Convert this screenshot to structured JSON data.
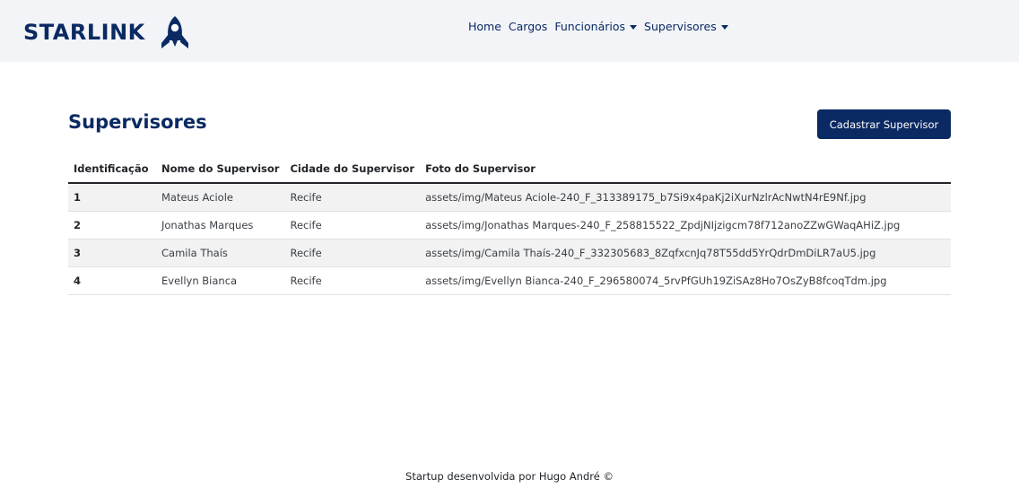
{
  "navbar": {
    "brand": "STARLINK",
    "logo_icon": "rocket-icon",
    "links": [
      "Home",
      "Cargos"
    ],
    "dropdowns": [
      "Funcionários",
      "Supervisores"
    ]
  },
  "page": {
    "title": "Supervisores",
    "add_button": "Cadastrar Supervisor"
  },
  "table": {
    "headers": [
      "Identificação",
      "Nome do Supervisor",
      "Cidade do Supervisor",
      "Foto do Supervisor"
    ],
    "rows": [
      [
        "1",
        "Mateus Aciole",
        "Recife",
        "assets/img/Mateus Aciole-240_F_313389175_b7Si9x4paKj2iXurNzlrAcNwtN4rE9Nf.jpg"
      ],
      [
        "2",
        "Jonathas Marques",
        "Recife",
        "assets/img/Jonathas Marques-240_F_258815522_ZpdjNIjzigcm78f712anoZZwGWaqAHiZ.jpg"
      ],
      [
        "3",
        "Camila Thaís",
        "Recife",
        "assets/img/Camila Thaís-240_F_332305683_8ZqfxcnJq78T55dd5YrQdrDmDiLR7aU5.jpg"
      ],
      [
        "4",
        "Evellyn Bianca",
        "Recife",
        "assets/img/Evellyn Bianca-240_F_296580074_5rvPfGUh19ZiSAz8Ho7OsZyB8fcoqTdm.jpg"
      ]
    ]
  },
  "footer": {
    "text": "Startup desenvolvida por Hugo André ©"
  },
  "colors": {
    "brand": "#0b2a63",
    "navbar_bg": "#f2f4f8",
    "stripe": "#f2f2f2"
  }
}
